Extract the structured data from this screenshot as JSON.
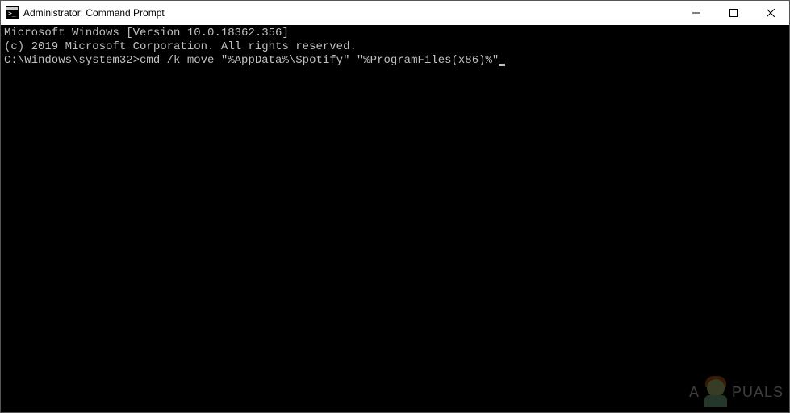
{
  "window": {
    "title": "Administrator: Command Prompt"
  },
  "terminal": {
    "line1": "Microsoft Windows [Version 10.0.18362.356]",
    "line2": "(c) 2019 Microsoft Corporation. All rights reserved.",
    "blank": "",
    "prompt": "C:\\Windows\\system32>",
    "command": "cmd /k move \"%AppData%\\Spotify\" \"%ProgramFiles(x86)%\""
  },
  "watermark": {
    "text1": "A",
    "text2": "PUALS"
  }
}
